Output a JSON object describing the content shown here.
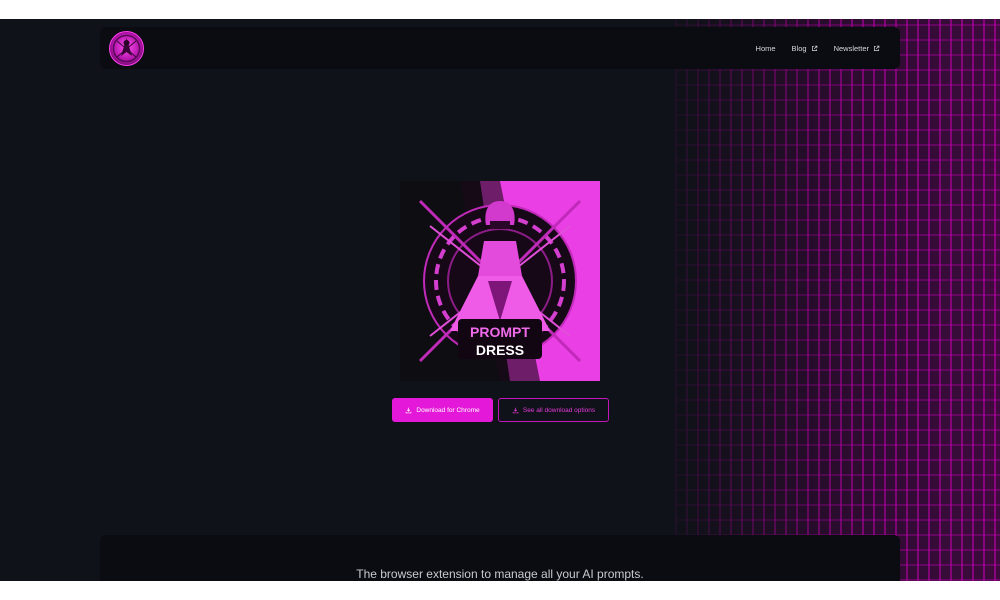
{
  "nav": {
    "logo_alt": "Prompt Dress logo",
    "links": [
      {
        "label": "Home",
        "external": false
      },
      {
        "label": "Blog",
        "external": true
      },
      {
        "label": "Newsletter",
        "external": true
      }
    ]
  },
  "hero": {
    "image_text_line1": "PROMPT",
    "image_text_line2": "DRESS"
  },
  "actions": {
    "primary_label": "Download for Chrome",
    "secondary_label": "See all download options"
  },
  "footer": {
    "tagline": "The browser extension to manage all your AI prompts."
  },
  "colors": {
    "accent": "#e418d8",
    "background": "#0f1218",
    "navbar": "#0a0c11"
  }
}
